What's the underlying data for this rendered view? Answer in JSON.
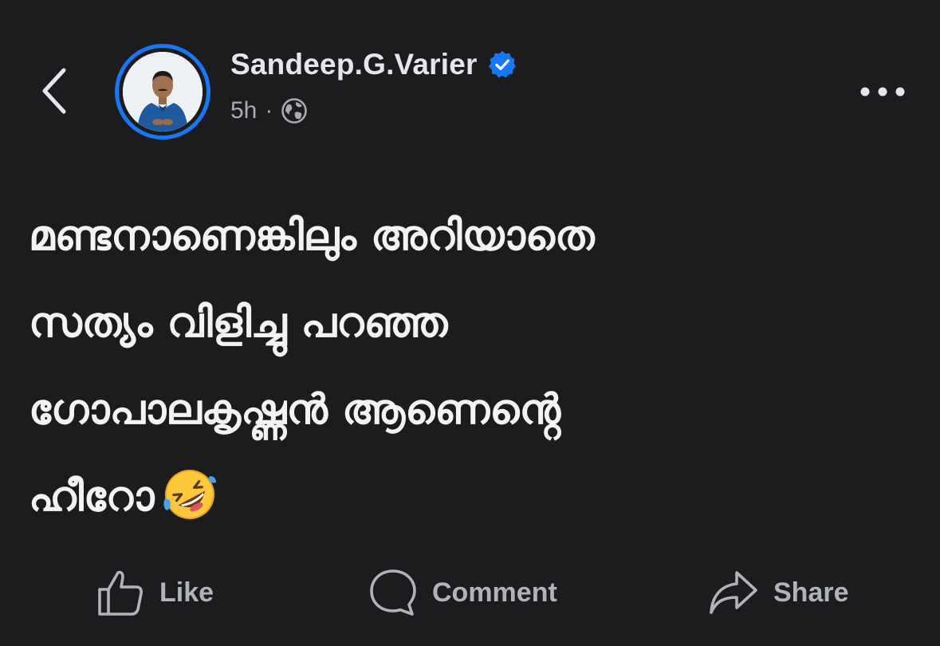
{
  "header": {
    "author_name": "Sandeep.G.Varier",
    "timestamp": "5h",
    "separator": "·",
    "audience_icon": "globe-icon",
    "verified_icon": "verified-badge-icon",
    "back_icon": "chevron-left-icon",
    "more_icon": "more-horizontal-icon"
  },
  "post": {
    "lines": [
      "മണ്ടനാണെങ്കിലും അറിയാതെ",
      "സത്യം വിളിച്ചു പറഞ്ഞ",
      "ഗോപാലകൃഷ്ണൻ ആണെൻ്റെ",
      "ഹീറോ"
    ],
    "emoji": "rolling-on-floor-laughing-emoji"
  },
  "actions": {
    "like_label": "Like",
    "comment_label": "Comment",
    "share_label": "Share"
  },
  "colors": {
    "background": "#1c1c1e",
    "accent": "#1877f2",
    "primary_text": "#e4e6eb",
    "secondary_text": "#a8abaf"
  }
}
